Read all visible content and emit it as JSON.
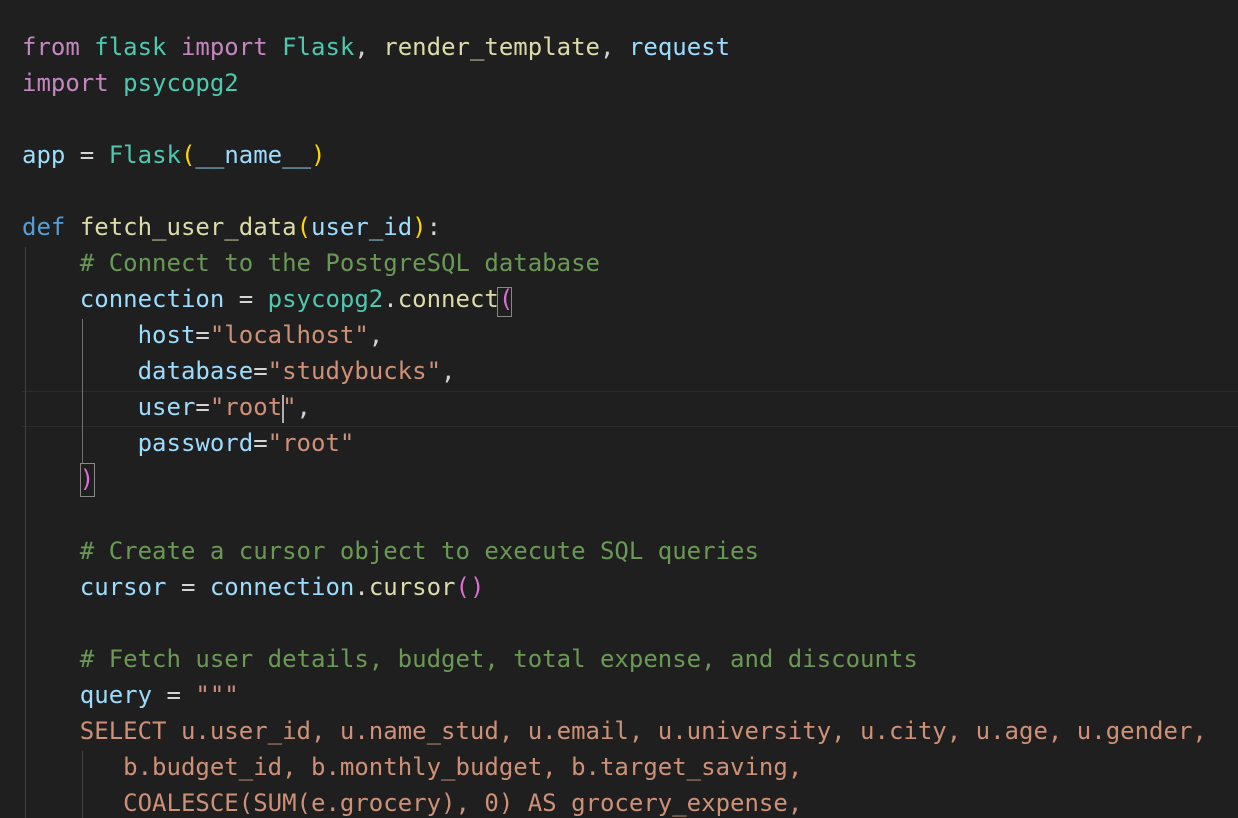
{
  "editor": {
    "colors": {
      "background": "#1f1f1f",
      "keyword_control": "#c586c0",
      "keyword_storage": "#569cd6",
      "class_name": "#4ec9b0",
      "function_name": "#dcdcaa",
      "variable": "#9cdcfe",
      "string": "#ce9178",
      "comment": "#6a9955",
      "bracket": "#ffd700"
    },
    "code": {
      "l1": {
        "from": "from",
        "mod": "flask",
        "import": "import",
        "cls": "Flask",
        "sep1": ", ",
        "fn": "render_template",
        "sep2": ", ",
        "var": "request"
      },
      "l2": {
        "import": "import",
        "mod": "psycopg2"
      },
      "l4": {
        "var": "app",
        "eq": " = ",
        "cls": "Flask",
        "open": "(",
        "arg": "__name__",
        "close": ")"
      },
      "l6": {
        "def": "def",
        "fn": "fetch_user_data",
        "open": "(",
        "arg": "user_id",
        "close": ")",
        "colon": ":"
      },
      "l7": {
        "comment": "# Connect to the PostgreSQL database"
      },
      "l8": {
        "var": "connection",
        "eq": " = ",
        "mod": "psycopg2",
        "dot": ".",
        "fn": "connect",
        "open": "("
      },
      "l9": {
        "key": "host",
        "eq": "=",
        "str": "\"localhost\"",
        "comma": ","
      },
      "l10": {
        "key": "database",
        "eq": "=",
        "str": "\"studybucks\"",
        "comma": ","
      },
      "l11": {
        "key": "user",
        "eq": "=",
        "str": "\"root\"",
        "comma": ","
      },
      "l12": {
        "key": "password",
        "eq": "=",
        "str": "\"root\""
      },
      "l13": {
        "close": ")"
      },
      "l15": {
        "comment": "# Create a cursor object to execute SQL queries"
      },
      "l16": {
        "var": "cursor",
        "eq": " = ",
        "obj": "connection",
        "dot": ".",
        "fn": "cursor",
        "parens": "()"
      },
      "l18": {
        "comment": "# Fetch user details, budget, total expense, and discounts"
      },
      "l19": {
        "var": "query",
        "eq": " = ",
        "str": "\"\"\""
      },
      "l20": {
        "str": "SELECT u.user_id, u.name_stud, u.email, u.university, u.city, u.age, u.gender,"
      },
      "l21": {
        "str": "b.budget_id, b.monthly_budget, b.target_saving,"
      },
      "l22": {
        "str": "COALESCE(SUM(e.grocery), 0) AS grocery_expense,"
      }
    }
  }
}
